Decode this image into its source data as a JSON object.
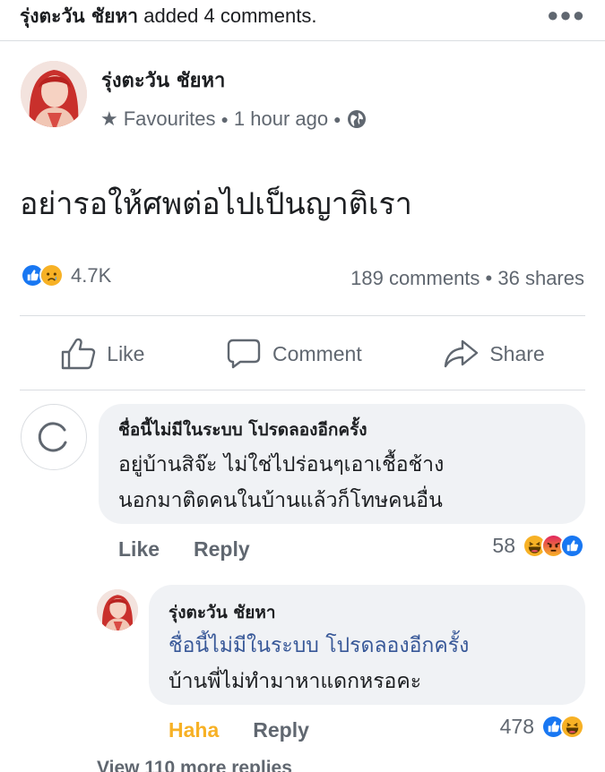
{
  "header": {
    "actor": "รุ่งตะวัน ชัยหา",
    "action": "added 4 comments.",
    "more_icon": "more-horizontal-icon"
  },
  "post": {
    "author": "รุ่งตะวัน ชัยหา",
    "audience": "Favourites",
    "time": "1 hour ago",
    "privacy_icon": "globe-icon",
    "text": "อย่ารอให้ศพต่อไปเป็นญาติเรา",
    "reactions": [
      "like",
      "sad"
    ],
    "reaction_count": "4.7K",
    "comments_count": "189 comments",
    "shares_count": "36 shares"
  },
  "actions": {
    "like": "Like",
    "comment": "Comment",
    "share": "Share"
  },
  "comments": [
    {
      "author": "ชื่อนี้ไม่มีในระบบ โปรดลองอีกครั้ง",
      "line1": "อยู่บ้านสิจ๊ะ ไม่ใช่ไปร่อนๆเอาเชื้อช้าง",
      "line2": "นอกมาติดคนในบ้านแล้วก็โทษคนอื่น",
      "like_label": "Like",
      "reply_label": "Reply",
      "reaction_count": "58",
      "reactions": [
        "haha",
        "angry",
        "like"
      ]
    },
    {
      "author": "รุ่งตะวัน ชัยหา",
      "mention": "ชื่อนี้ไม่มีในระบบ โปรดลองอีกครั้ง",
      "line2": "บ้านพี่ไม่ทำมาหาแดกหรอคะ",
      "like_label": "Haha",
      "reply_label": "Reply",
      "reaction_count": "478",
      "reactions": [
        "like",
        "haha"
      ]
    }
  ],
  "more_replies": "View 110 more replies",
  "colors": {
    "like_blue": "#1877f2",
    "haha_yellow": "#f7b125",
    "angry_orange": "#e9710f",
    "mention_blue": "#385898",
    "secondary_text": "#606770"
  }
}
